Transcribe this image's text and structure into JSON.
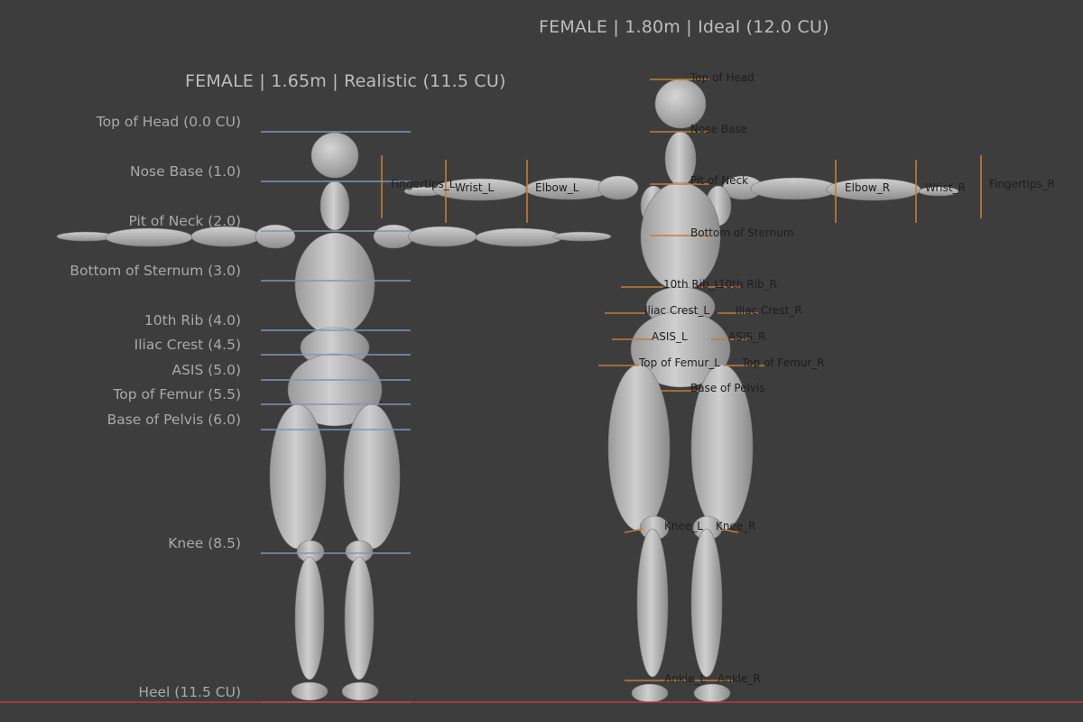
{
  "viewport": {
    "left_figure": {
      "title": "FEMALE | 1.65m | Realistic (11.5 CU)",
      "landmarks": [
        "Top of Head (0.0 CU)",
        "Nose Base (1.0)",
        "Pit of Neck (2.0)",
        "Bottom of Sternum (3.0)",
        "10th Rib (4.0)",
        "Iliac Crest (4.5)",
        "ASIS (5.0)",
        "Top of Femur (5.5)",
        "Base of Pelvis (6.0)",
        "Knee (8.5)",
        "Heel (11.5 CU)"
      ]
    },
    "right_figure": {
      "title": "FEMALE | 1.80m | Ideal (12.0 CU)",
      "labels": [
        "Top of Head",
        "Nose Base",
        "Pit of Neck",
        "Bottom of Sternum",
        "10th Rib_L",
        "10th Rib_R",
        "Iliac Crest_L",
        "Iliac Crest_R",
        "ASIS_L",
        "ASIS_R",
        "Top of Femur_L",
        "Top of Femur_R",
        "Base of Pelvis",
        "Knee_L",
        "Knee_R",
        "Ankle_L",
        "Ankle_R",
        "Fingertips_L",
        "Wrist_L",
        "Elbow_L",
        "Elbow_R",
        "Wrist_R",
        "Fingertips_R"
      ]
    },
    "colors": {
      "background": "#3d3d3d",
      "body": "#b7b7b7",
      "landmark_line_left": "#7f97b0",
      "landmark_line_right": "#c07d3a",
      "ground_line": "#c0393b"
    }
  }
}
